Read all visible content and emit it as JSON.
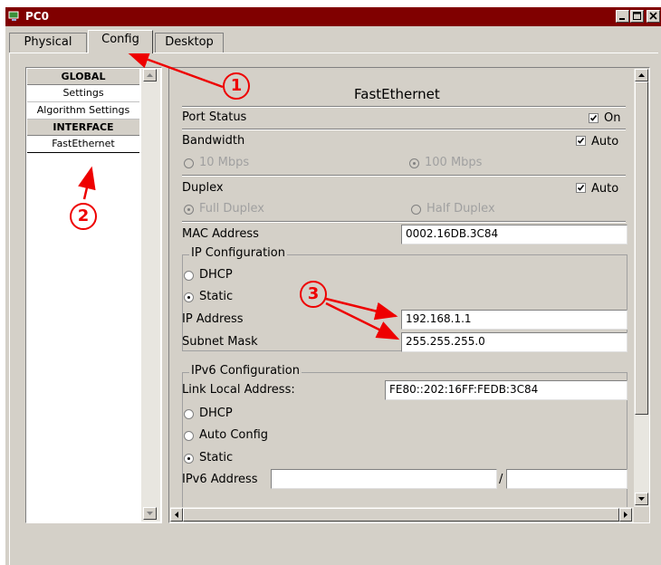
{
  "window": {
    "title": "PC0"
  },
  "tabs": [
    {
      "label": "Physical"
    },
    {
      "label": "Config"
    },
    {
      "label": "Desktop"
    }
  ],
  "nav": {
    "global_header": "GLOBAL",
    "settings": "Settings",
    "algorithm_settings": "Algorithm Settings",
    "interface_header": "INTERFACE",
    "fastethernet": "FastEthernet"
  },
  "interface": {
    "heading": "FastEthernet",
    "port_status_label": "Port Status",
    "port_status_on_label": "On",
    "port_status_on": true,
    "bandwidth_label": "Bandwidth",
    "bandwidth_auto_label": "Auto",
    "bandwidth_auto": true,
    "bw_10": "10 Mbps",
    "bw_100": "100 Mbps",
    "duplex_label": "Duplex",
    "duplex_auto_label": "Auto",
    "duplex_auto": true,
    "full_duplex": "Full Duplex",
    "half_duplex": "Half Duplex",
    "mac_label": "MAC Address",
    "mac_value": "0002.16DB.3C84"
  },
  "ip_config": {
    "title": "IP Configuration",
    "dhcp": "DHCP",
    "static": "Static",
    "ip_label": "IP Address",
    "ip_value": "192.168.1.1",
    "mask_label": "Subnet Mask",
    "mask_value": "255.255.255.0"
  },
  "ipv6_config": {
    "title": "IPv6 Configuration",
    "link_local_label": "Link Local Address:",
    "link_local_value": "FE80::202:16FF:FEDB:3C84",
    "dhcp": "DHCP",
    "auto_config": "Auto Config",
    "static": "Static",
    "ipv6_label": "IPv6 Address",
    "ipv6_value": "",
    "ipv6_sep": "/",
    "prefix_value": ""
  },
  "annotations": [
    "1",
    "2",
    "3"
  ],
  "colors": {
    "titlebar": "#800000",
    "annotation": "#e00000",
    "face": "#d4d0c8"
  }
}
